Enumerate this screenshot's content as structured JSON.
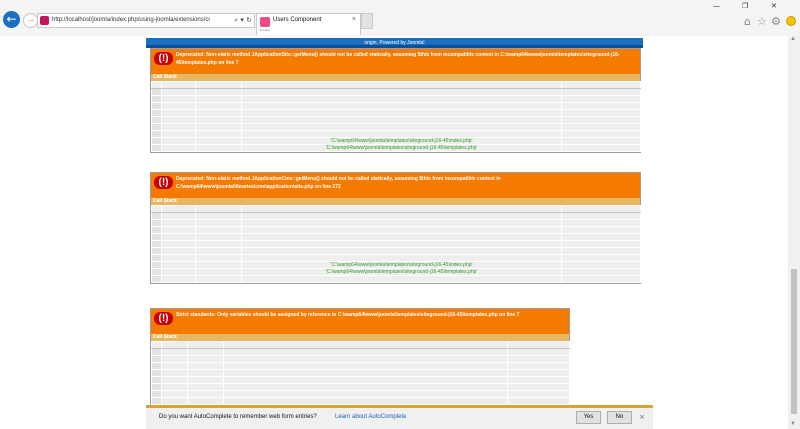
{
  "browser": {
    "url": "http://localhost/joomla/index.php/using-joomla/extensions/co",
    "tab_title": "Users Component",
    "tab_subtitle": "Joomla!",
    "nav": {
      "back_glyph": "←",
      "forward_glyph": "→"
    },
    "address_tools": "⌕ ▾ ↻",
    "tab_close": "×",
    "window": {
      "minimize": "—",
      "maximize": "❐",
      "close": "✕"
    },
    "toolbar_icons": [
      "home-icon",
      "star-icon",
      "gear-icon",
      "smiley-icon"
    ],
    "accent_color": "#1b6fc2"
  },
  "page": {
    "footer_text": "origin, Powered by Joomla!",
    "footer_color": "#1a6fc1",
    "error_header_color": "#f47b00",
    "call_stack_color": "#e8b764",
    "errors": [
      {
        "message": "Deprecated: Non-static method JApplicationSite::getMenu() should not be called statically, assuming $this from incompatible context in C:\\wamp64\\www\\joomla\\templates\\siteground-j16-45\\templates.php on line 7",
        "call_stack_label": "Call Stack",
        "stack_files": [
          "'C:\\wamp64\\www\\joomla\\templates\\siteground-j16-45\\index.php'",
          "'C:\\wamp64\\www\\joomla\\templates\\siteground-j16-45\\templates.php'"
        ]
      },
      {
        "message": "Deprecated: Non-static method JApplicationCms::getMenu() should not be called statically, assuming $this from incompatible context in C:\\wamp64\\www\\joomla\\libraries\\cms\\application\\site.php on line 272",
        "call_stack_label": "Call Stack",
        "stack_files": [
          "'C:\\wamp64\\www\\joomla\\templates\\siteground-j16-45\\index.php'",
          "'C:\\wamp64\\www\\joomla\\templates\\siteground-j16-45\\templates.php'"
        ]
      },
      {
        "message": "Strict standards: Only variables should be assigned by reference in C:\\wamp64\\www\\joomla\\templates\\siteground-j16-45\\templates.php on line 7",
        "call_stack_label": "Call Stack",
        "stack_files": []
      }
    ]
  },
  "autocomplete": {
    "message": "Do you want AutoComplete to remember web form entries?",
    "learn_link": "Learn about AutoComplete",
    "yes_label": "Yes",
    "no_label": "No",
    "close_glyph": "×"
  }
}
